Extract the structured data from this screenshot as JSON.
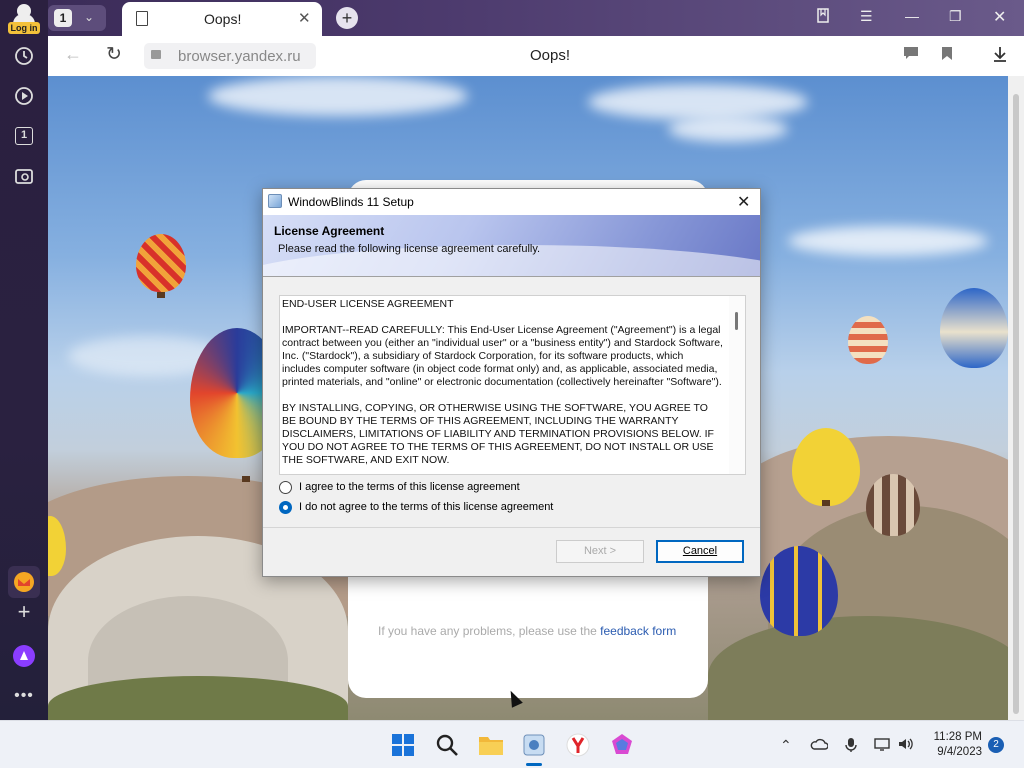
{
  "sidebar": {
    "login_label": "Log in",
    "icons": [
      "history-icon",
      "play-icon",
      "tab-counter-icon",
      "screenshot-icon",
      "mail-icon",
      "add-icon",
      "alice-assistant-icon",
      "more-icon"
    ],
    "tab_counter": "1"
  },
  "tabbar": {
    "tab_count": "1",
    "active_tab_title": "Oops!"
  },
  "address_bar": {
    "url": "browser.yandex.ru",
    "page_title": "Oops!"
  },
  "page_card": {
    "help_text": "If you have any problems, please use the",
    "help_link": "feedback form"
  },
  "dialog": {
    "title": "WindowBlinds 11 Setup",
    "heading": "License Agreement",
    "subheading": "Please read the following license agreement carefully.",
    "license_paragraphs": [
      "END-USER LICENSE AGREEMENT",
      "IMPORTANT--READ CAREFULLY: This End-User License Agreement (\"Agreement\") is a legal contract between you (either an \"individual user\" or a \"business entity\") and Stardock Software, Inc. (\"Stardock\"), a subsidiary of Stardock Corporation, for its software products, which includes computer software (in object code format only) and, as applicable, associated media, printed materials, and \"online\" or electronic documentation (collectively hereinafter \"Software\").",
      "BY INSTALLING, COPYING, OR OTHERWISE USING THE SOFTWARE, YOU AGREE TO BE BOUND BY THE TERMS OF THIS AGREEMENT, INCLUDING THE WARRANTY DISCLAIMERS, LIMITATIONS OF LIABILITY AND TERMINATION PROVISIONS BELOW. IF YOU DO NOT AGREE TO THE TERMS OF THIS AGREEMENT, DO NOT INSTALL OR USE THE SOFTWARE, AND EXIT NOW."
    ],
    "radio_agree": "I agree to the terms of this license agreement",
    "radio_disagree": "I do not agree to the terms of this license agreement",
    "selected_option": "disagree",
    "next_button": "Next >",
    "cancel_button": "Cancel"
  },
  "taskbar": {
    "apps": [
      "start-icon",
      "search-icon",
      "file-explorer-icon",
      "setup-installer-icon",
      "yandex-browser-icon",
      "paint-app-icon"
    ],
    "time": "11:28 PM",
    "date": "9/4/2023",
    "notification_count": "2"
  },
  "colors": {
    "accent": "#0067c0",
    "sidebar_bg": "#2b2040",
    "login_badge": "#f3c13a",
    "link": "#2a5bb0"
  }
}
